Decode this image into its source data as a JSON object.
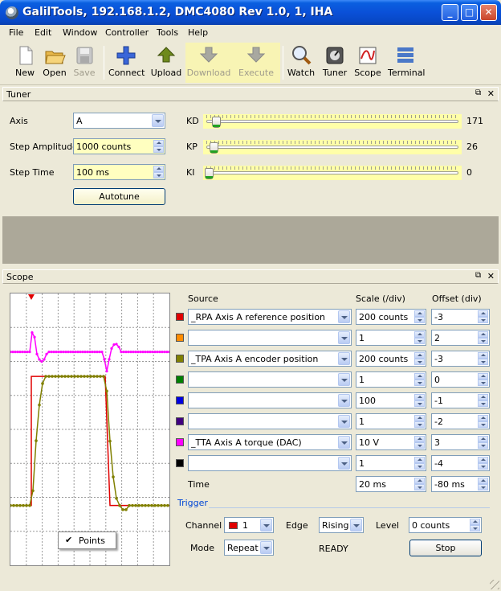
{
  "window": {
    "title": "GalilTools, 192.168.1.2, DMC4080 Rev 1.0, 1, IHA",
    "min": "_",
    "max": "□",
    "close": "✕"
  },
  "menu": [
    "File",
    "Edit",
    "Window",
    "Controller",
    "Tools",
    "Help"
  ],
  "toolbar": [
    {
      "label": "New",
      "icon": "new-file-icon",
      "enabled": true
    },
    {
      "label": "Open",
      "icon": "open-folder-icon",
      "enabled": true
    },
    {
      "label": "Save",
      "icon": "save-disk-icon",
      "enabled": false
    },
    {
      "label": "Connect",
      "icon": "connect-plus-icon",
      "enabled": true
    },
    {
      "label": "Upload",
      "icon": "upload-arrow-icon",
      "enabled": true
    },
    {
      "label": "Download",
      "icon": "download-arrow-icon",
      "enabled": false
    },
    {
      "label": "Execute",
      "icon": "execute-arrow-icon",
      "enabled": false
    },
    {
      "label": "Watch",
      "icon": "magnifier-watch-icon",
      "enabled": true
    },
    {
      "label": "Tuner",
      "icon": "tuner-icon",
      "enabled": true
    },
    {
      "label": "Scope",
      "icon": "scope-icon",
      "enabled": true
    },
    {
      "label": "Terminal",
      "icon": "terminal-icon",
      "enabled": true
    }
  ],
  "tuner": {
    "title": "Tuner",
    "axis_label": "Axis",
    "axis_value": "A",
    "step_amplitude_label": "Step Amplitude",
    "step_amplitude_value": "1000 counts",
    "step_time_label": "Step Time",
    "step_time_value": "100 ms",
    "autotune_label": "Autotune",
    "gains": [
      {
        "name": "KD",
        "value": "171",
        "fraction": 0.03
      },
      {
        "name": "KP",
        "value": "26",
        "fraction": 0.02
      },
      {
        "name": "KI",
        "value": "0",
        "fraction": 0.0
      }
    ]
  },
  "scope": {
    "title": "Scope",
    "headers": {
      "source": "Source",
      "scale": "Scale (/div)",
      "offset": "Offset (div)"
    },
    "channels": [
      {
        "color": "#e00000",
        "source": "_RPA Axis A reference position",
        "scale": "200 counts",
        "offset": "-3"
      },
      {
        "color": "#ff8c00",
        "source": "",
        "scale": "1",
        "offset": "2"
      },
      {
        "color": "#808000",
        "source": "_TPA Axis A encoder position",
        "scale": "200 counts",
        "offset": "-3"
      },
      {
        "color": "#008000",
        "source": "",
        "scale": "1",
        "offset": "0"
      },
      {
        "color": "#0000e0",
        "source": "",
        "scale": "100",
        "offset": "-1"
      },
      {
        "color": "#400080",
        "source": "",
        "scale": "1",
        "offset": "-2"
      },
      {
        "color": "#ff00ff",
        "source": "_TTA Axis A torque (DAC)",
        "scale": "10 V",
        "offset": "3"
      },
      {
        "color": "#000000",
        "source": "",
        "scale": "1",
        "offset": "-4"
      }
    ],
    "time_label": "Time",
    "time_scale": "20 ms",
    "time_offset": "-80 ms",
    "trigger_title": "Trigger",
    "channel_label": "Channel",
    "channel_value": "1",
    "channel_color": "#e00000",
    "edge_label": "Edge",
    "edge_value": "Rising",
    "level_label": "Level",
    "level_value": "0 counts",
    "mode_label": "Mode",
    "mode_value": "Repeat",
    "status": "READY",
    "stop_label": "Stop",
    "points_label": "Points",
    "points_check": "✔"
  }
}
